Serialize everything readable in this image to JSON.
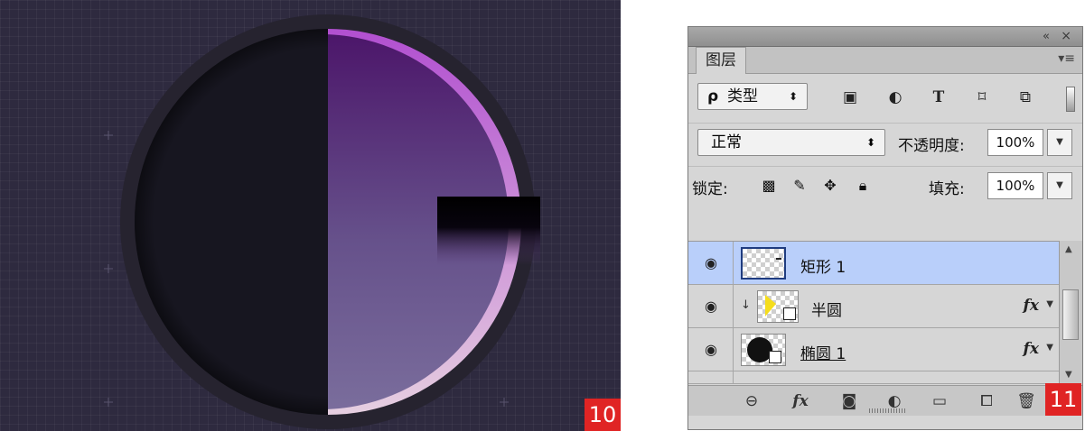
{
  "canvas": {
    "background": "#2e2a3f",
    "circle_ring_color": "#26232f",
    "left_half_color": "#171620",
    "right_half_gradient": [
      "#4f1b6b",
      "#76659b"
    ],
    "badge": "10",
    "badge_color": "#e02424"
  },
  "layers_panel": {
    "tab_label": "图层",
    "filter": {
      "kind_label": "类型",
      "icons": [
        "image-filter-icon",
        "adjustment-filter-icon",
        "type-filter-icon",
        "shape-filter-icon",
        "smart-object-filter-icon"
      ],
      "type_glyph": "T"
    },
    "blend_mode": "正常",
    "opacity_label": "不透明度:",
    "opacity_value": "100%",
    "lock_label": "锁定:",
    "fill_label": "填充:",
    "fill_value": "100%",
    "layers": [
      {
        "name": "矩形 1",
        "selected": true,
        "has_fx": false
      },
      {
        "name": "半圆",
        "selected": false,
        "has_fx": true,
        "clipped": true
      },
      {
        "name": "椭圆 1",
        "selected": false,
        "has_fx": true
      }
    ],
    "fx_label": "fx",
    "bottom_icons": [
      "link-layers-icon",
      "add-style-icon",
      "add-mask-icon",
      "new-adjustment-icon",
      "new-group-icon",
      "new-layer-icon",
      "delete-layer-icon"
    ],
    "badge": "11",
    "selection_color": "#b9cffa"
  }
}
